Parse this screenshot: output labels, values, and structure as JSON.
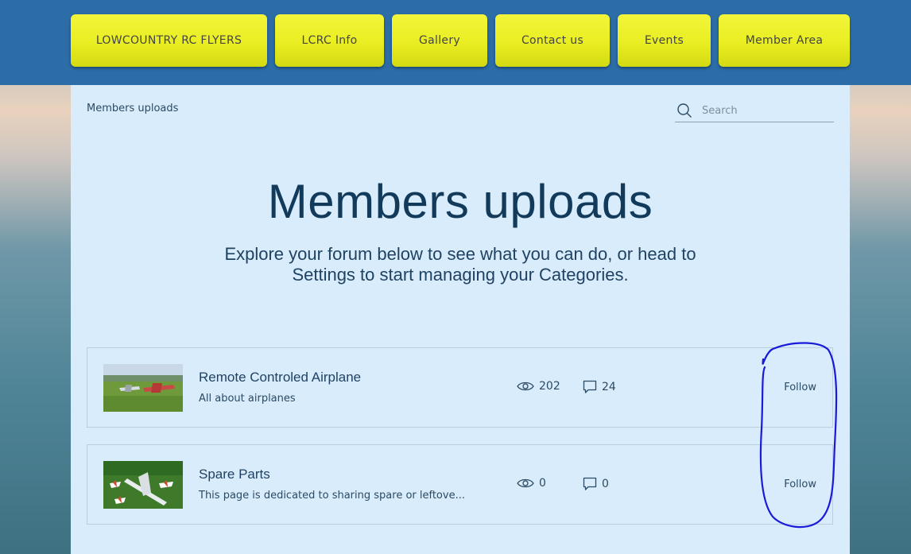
{
  "nav": {
    "items": [
      {
        "label": "LOWCOUNTRY RC FLYERS"
      },
      {
        "label": "LCRC Info"
      },
      {
        "label": "Gallery"
      },
      {
        "label": "Contact us"
      },
      {
        "label": "Events"
      },
      {
        "label": "Member Area"
      }
    ]
  },
  "header": {
    "breadcrumb": "Members uploads",
    "search_placeholder": "Search"
  },
  "main": {
    "title": "Members uploads",
    "subtitle": "Explore your forum below to see what you can do, or head to Settings to start managing your Categories."
  },
  "categories": [
    {
      "name": "Remote Controled Airplane",
      "description": "All about airplanes",
      "views": "202",
      "comments": "24",
      "follow_label": "Follow",
      "thumb_icon": "airplane-photo"
    },
    {
      "name": "Spare Parts",
      "description": "This page is dedicated to sharing spare or leftove...",
      "views": "0",
      "comments": "0",
      "follow_label": "Follow",
      "thumb_icon": "airplanes-on-grass-photo"
    }
  ],
  "colors": {
    "nav_bar": "#2c6ca7",
    "nav_button": "#e9ee22",
    "panel": "#d9ecfb",
    "title_text": "#123a5b",
    "annotation": "#1a1adb"
  }
}
